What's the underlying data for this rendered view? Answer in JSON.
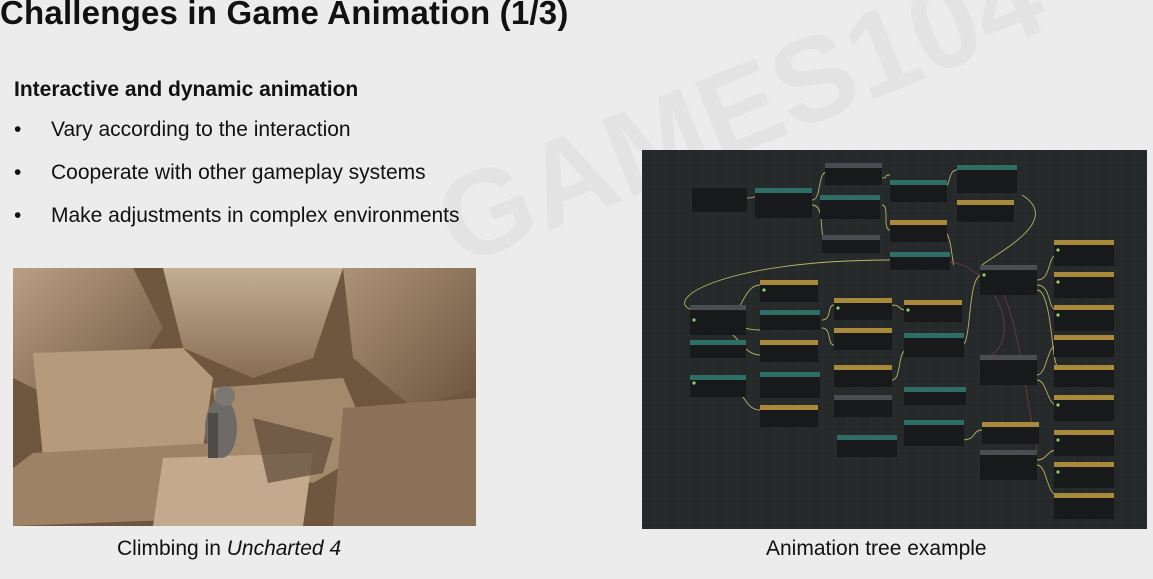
{
  "slide": {
    "title": "Challenges in Game Animation (1/3)",
    "subtitle": "Interactive and dynamic animation",
    "bullets": [
      "Vary according to the interaction",
      "Cooperate with other gameplay systems",
      "Make adjustments in complex environments"
    ],
    "bullet_glyph": "•",
    "caption_left_prefix": "Climbing in ",
    "caption_left_game": "Uncharted 4",
    "caption_right": "Animation tree example",
    "watermark": "GAMES104"
  },
  "colors": {
    "background": "#ececec",
    "tree_bg": "#25292a",
    "node_header_gold": "#a98a3a",
    "node_header_teal": "#2f6e64",
    "node_header_grey": "#4a4e52",
    "wire": "#c9c36a"
  }
}
